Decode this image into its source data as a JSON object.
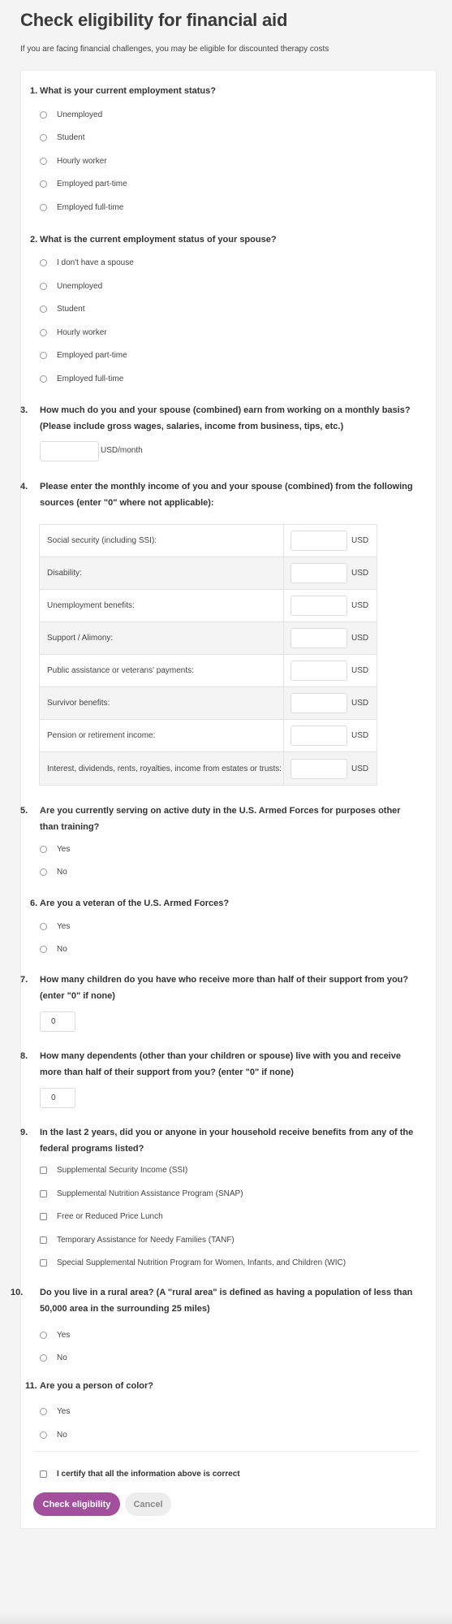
{
  "header": {
    "title": "Check eligibility for financial aid",
    "subtitle": "If you are facing financial challenges, you may be eligible for discounted therapy costs"
  },
  "questions": {
    "q1": {
      "number": "1.",
      "text": "What is your current employment status?",
      "options": [
        "Unemployed",
        "Student",
        "Hourly worker",
        "Employed part-time",
        "Employed full-time"
      ]
    },
    "q2": {
      "number": "2.",
      "text": "What is the current employment status of your spouse?",
      "options": [
        "I don't have a spouse",
        "Unemployed",
        "Student",
        "Hourly worker",
        "Employed part-time",
        "Employed full-time"
      ]
    },
    "q3": {
      "number": "3.",
      "text": "How much do you and your spouse (combined) earn from working on a monthly basis? (Please include gross wages, salaries, income from business, tips, etc.)",
      "value": "",
      "suffix": "USD/month"
    },
    "q4": {
      "number": "4.",
      "text": "Please enter the monthly income of you and your spouse (combined) from the following sources (enter \"0\" where not applicable):",
      "unit": "USD",
      "rows": [
        {
          "label": "Social security (including SSI):",
          "value": ""
        },
        {
          "label": "Disability:",
          "value": ""
        },
        {
          "label": "Unemployment benefits:",
          "value": ""
        },
        {
          "label": "Support / Alimony:",
          "value": ""
        },
        {
          "label": "Public assistance or veterans' payments:",
          "value": ""
        },
        {
          "label": "Survivor benefits:",
          "value": ""
        },
        {
          "label": "Pension or retirement income:",
          "value": ""
        },
        {
          "label": "Interest, dividends, rents, royalties, income from estates or trusts:",
          "value": ""
        }
      ]
    },
    "q5": {
      "number": "5.",
      "text": "Are you currently serving on active duty in the U.S. Armed Forces for purposes other than training?",
      "options": [
        "Yes",
        "No"
      ]
    },
    "q6": {
      "number": "6.",
      "text": "Are you a veteran of the U.S. Armed Forces?",
      "options": [
        "Yes",
        "No"
      ]
    },
    "q7": {
      "number": "7.",
      "text": "How many children do you have who receive more than half of their support from you? (enter \"0\" if none)",
      "value": "0"
    },
    "q8": {
      "number": "8.",
      "text": "How many dependents (other than your children or spouse) live with you and receive more than half of their support from you? (enter \"0\" if none)",
      "value": "0"
    },
    "q9": {
      "number": "9.",
      "text": "In the last 2 years, did you or anyone in your household receive benefits from any of the federal programs listed?",
      "options": [
        "Supplemental Security Income (SSI)",
        "Supplemental Nutrition Assistance Program (SNAP)",
        "Free or Reduced Price Lunch",
        "Temporary Assistance for Needy Families (TANF)",
        "Special Supplemental Nutrition Program for Women, Infants, and Children (WIC)"
      ]
    },
    "q10": {
      "number": "10.",
      "text": "Do you live in a rural area? (A \"rural area\" is defined as having a population of less than 50,000 area in the surrounding 25 miles)",
      "options": [
        "Yes",
        "No"
      ]
    },
    "q11": {
      "number": "11.",
      "text": "Are you a person of color?",
      "options": [
        "Yes",
        "No"
      ]
    }
  },
  "certify": {
    "label": "I certify that all the information above is correct",
    "checked": false
  },
  "actions": {
    "submit_label": "Check eligibility",
    "cancel_label": "Cancel"
  },
  "colors": {
    "primary": "#a44f9e",
    "background": "#f4f4f4",
    "card": "#ffffff"
  }
}
